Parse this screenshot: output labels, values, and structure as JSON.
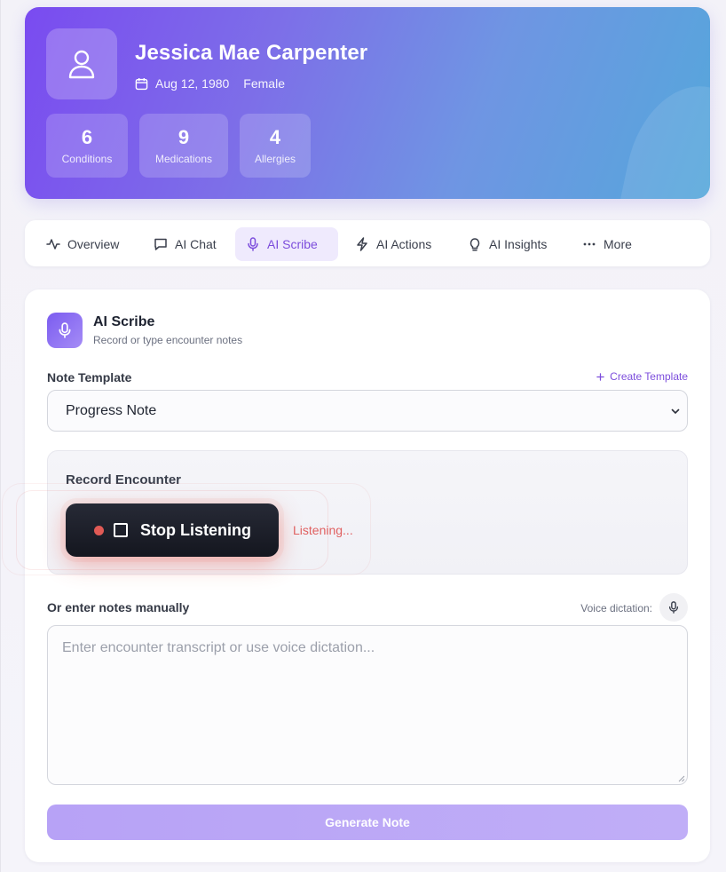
{
  "patient": {
    "name": "Jessica Mae Carpenter",
    "dob": "Aug 12, 1980",
    "sex": "Female",
    "stats": [
      {
        "value": "6",
        "label": "Conditions"
      },
      {
        "value": "9",
        "label": "Medications"
      },
      {
        "value": "4",
        "label": "Allergies"
      }
    ]
  },
  "tabs": [
    {
      "label": "Overview",
      "icon": "activity-icon"
    },
    {
      "label": "AI Chat",
      "icon": "chat-icon"
    },
    {
      "label": "AI Scribe",
      "icon": "microphone-icon",
      "active": true
    },
    {
      "label": "AI Actions",
      "icon": "lightning-icon"
    },
    {
      "label": "AI Insights",
      "icon": "lightbulb-icon"
    },
    {
      "label": "More",
      "icon": "more-dots-icon"
    }
  ],
  "scribe": {
    "title": "AI Scribe",
    "subtitle": "Record or type encounter notes",
    "template_label": "Note Template",
    "create_template": "Create Template",
    "template_selected": "Progress Note",
    "record_title": "Record Encounter",
    "stop_label": "Stop Listening",
    "status": "Listening...",
    "manual_label": "Or enter notes manually",
    "voice_label": "Voice dictation:",
    "notes_placeholder": "Enter encounter transcript or use voice dictation...",
    "generate_label": "Generate Note"
  },
  "colors": {
    "accent": "#7c4ddc",
    "recording": "#e05a55",
    "header_gradient_start": "#7a4bf0",
    "header_gradient_end": "#55a7db"
  }
}
